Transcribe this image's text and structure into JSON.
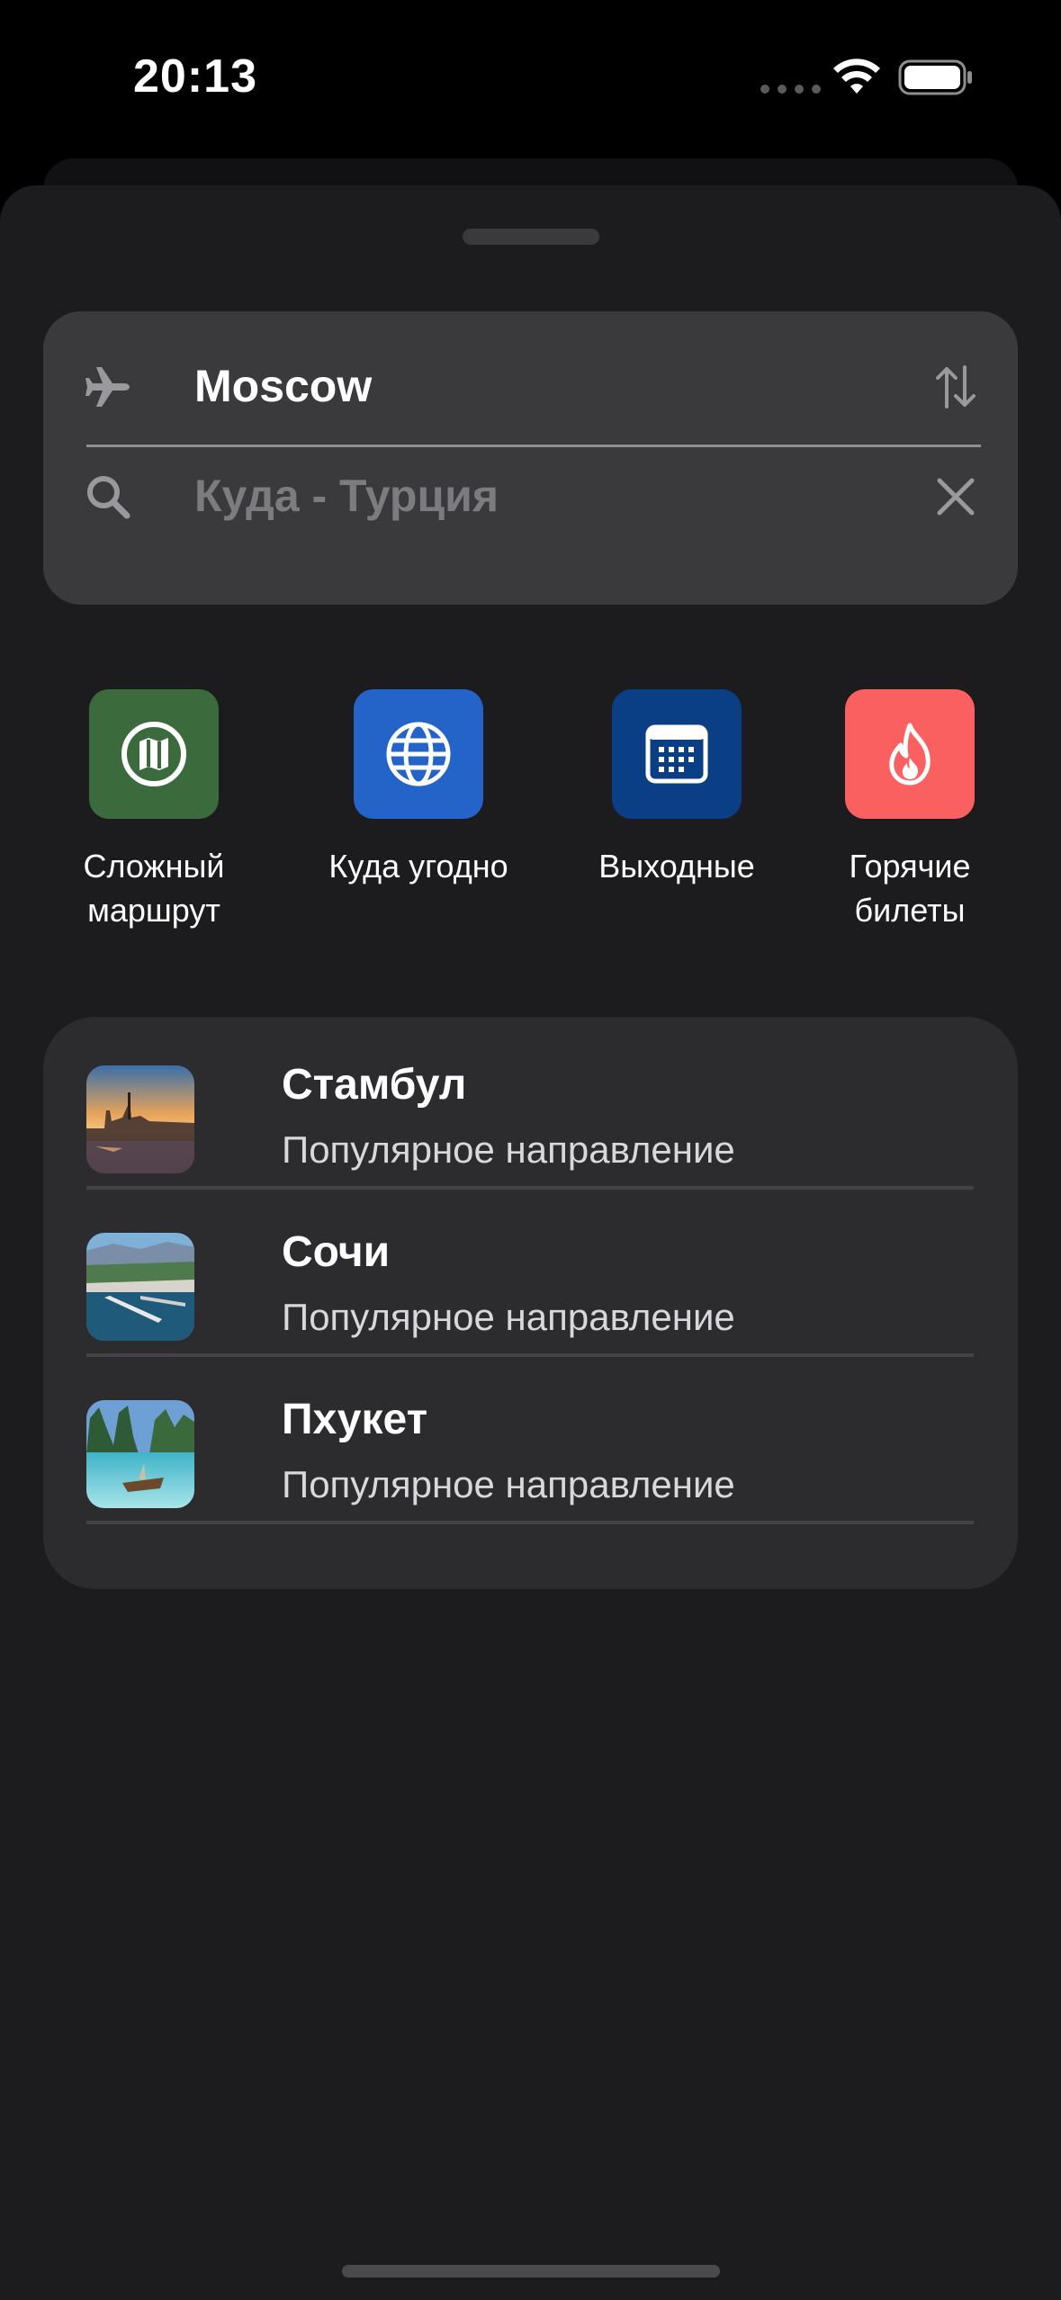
{
  "status_bar": {
    "time": "20:13"
  },
  "search": {
    "from_value": "Moscow",
    "to_placeholder": "Куда - Турция",
    "icons": {
      "from": "airplane-icon",
      "swap": "swap-arrows-icon",
      "to": "search-icon",
      "clear": "close-icon"
    }
  },
  "quick_actions": [
    {
      "label": "Сложный\nмаршрут",
      "icon": "map-icon",
      "color": "#3b6a3c"
    },
    {
      "label": "Куда угодно",
      "icon": "globe-icon",
      "color": "#2464c8"
    },
    {
      "label": "Выходные",
      "icon": "calendar-icon",
      "color": "#0a3f86"
    },
    {
      "label": "Горячие\nбилеты",
      "icon": "flame-icon",
      "color": "#fb6060"
    }
  ],
  "destinations": [
    {
      "title": "Стамбул",
      "subtitle": "Популярное направление",
      "thumb": "istanbul-photo"
    },
    {
      "title": "Сочи",
      "subtitle": "Популярное направление",
      "thumb": "sochi-photo"
    },
    {
      "title": "Пхукет",
      "subtitle": "Популярное направление",
      "thumb": "phuket-photo"
    }
  ],
  "colors": {
    "sheet_background": "#1c1c1e",
    "search_card": "#3a3a3c",
    "destinations_card": "#2c2c2e",
    "placeholder_text": "#7c7c80"
  }
}
